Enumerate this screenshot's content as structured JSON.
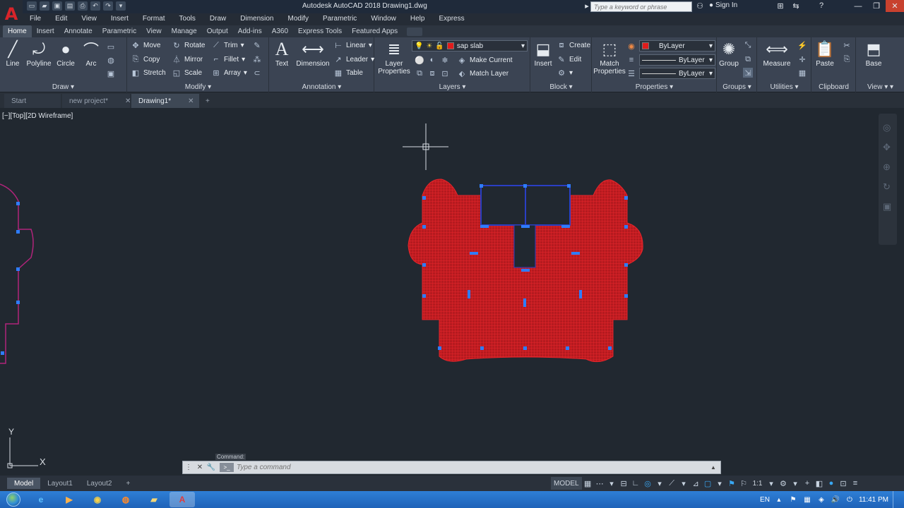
{
  "app": {
    "logo_letter": "A",
    "title": "Autodesk AutoCAD 2018   Drawing1.dwg",
    "search_placeholder": "Type a keyword or phrase",
    "sign_in": "Sign In"
  },
  "menubar": [
    "File",
    "Edit",
    "View",
    "Insert",
    "Format",
    "Tools",
    "Draw",
    "Dimension",
    "Modify",
    "Parametric",
    "Window",
    "Help",
    "Express"
  ],
  "ribbon_tabs": [
    "Home",
    "Insert",
    "Annotate",
    "Parametric",
    "View",
    "Manage",
    "Output",
    "Add-ins",
    "A360",
    "Express Tools",
    "Featured Apps"
  ],
  "draw": {
    "title": "Draw",
    "line": "Line",
    "polyline": "Polyline",
    "circle": "Circle",
    "arc": "Arc"
  },
  "modify": {
    "title": "Modify",
    "move": "Move",
    "rotate": "Rotate",
    "trim": "Trim",
    "copy": "Copy",
    "mirror": "Mirror",
    "fillet": "Fillet",
    "stretch": "Stretch",
    "scale": "Scale",
    "array": "Array"
  },
  "annotation": {
    "title": "Annotation",
    "text": "Text",
    "dimension": "Dimension",
    "linear": "Linear",
    "leader": "Leader",
    "table": "Table"
  },
  "layers": {
    "title": "Layers",
    "layer_properties_1": "Layer",
    "layer_properties_2": "Properties",
    "current_layer": "sap slab",
    "make_current": "Make Current",
    "match_layer": "Match Layer"
  },
  "block": {
    "title": "Block",
    "insert": "Insert",
    "create": "Create",
    "edit": "Edit"
  },
  "properties": {
    "title": "Properties",
    "match_1": "Match",
    "match_2": "Properties",
    "color": "ByLayer",
    "linetype": "ByLayer",
    "lineweight": "ByLayer"
  },
  "groups": {
    "title": "Groups",
    "group": "Group"
  },
  "utilities": {
    "title": "Utilities",
    "measure": "Measure"
  },
  "clipboard": {
    "title": "Clipboard",
    "paste": "Paste"
  },
  "view_panel": {
    "title": "View",
    "base": "Base"
  },
  "doc_tabs": [
    "Start",
    "new project*",
    "Drawing1*"
  ],
  "viewport": {
    "label": "[−][Top][2D Wireframe]"
  },
  "ucs": {
    "y": "Y",
    "x": "X"
  },
  "command": {
    "history": "Command:",
    "placeholder": "Type a command"
  },
  "layout_tabs": [
    "Model",
    "Layout1",
    "Layout2"
  ],
  "status": {
    "model": "MODEL",
    "scale": "1:1"
  },
  "tray": {
    "lang": "EN",
    "time": "11:41 PM"
  },
  "colors": {
    "accent": "#39a8f4",
    "slab": "#d21f24",
    "grips": "#2e7dff",
    "outline": "#b0247a"
  }
}
